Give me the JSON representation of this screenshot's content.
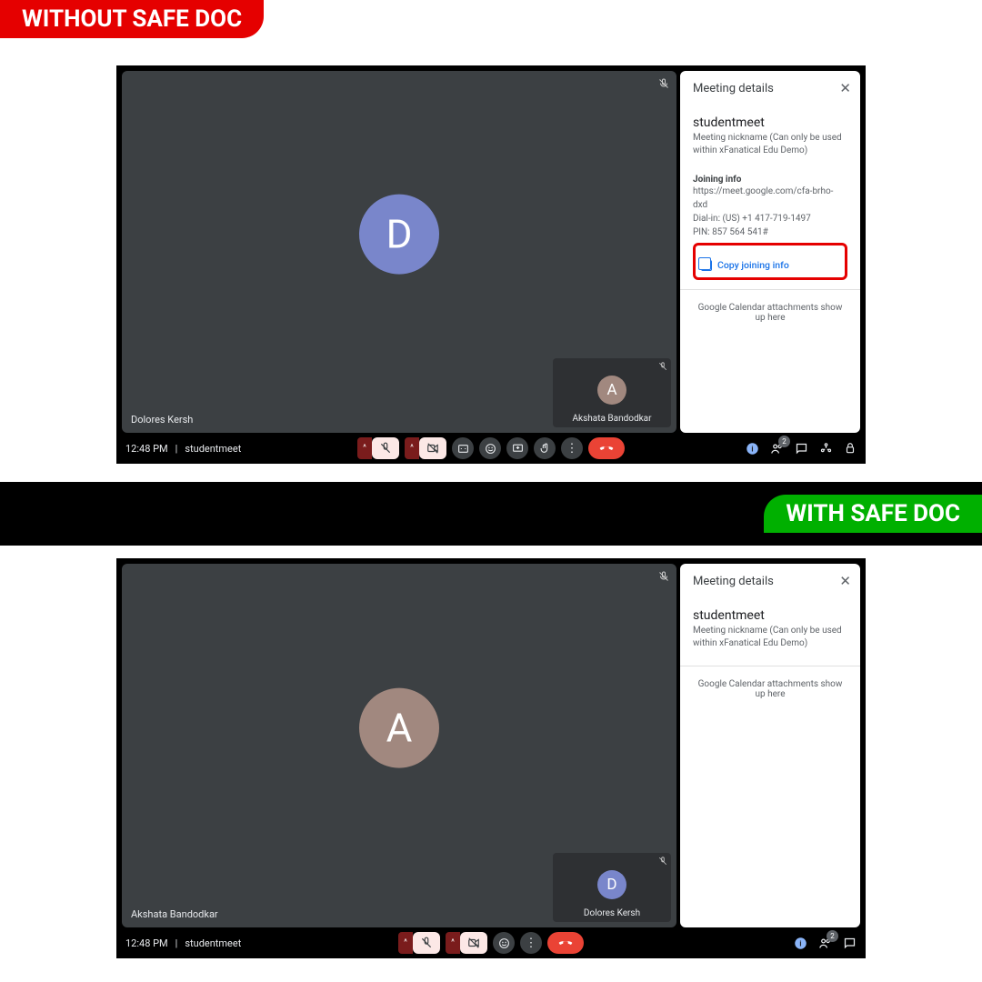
{
  "banners": {
    "top": "WITHOUT SAFE DOC",
    "bottom": "WITH SAFE DOC"
  },
  "shot1": {
    "panel": {
      "title": "Meeting details",
      "meeting_name": "studentmeet",
      "meeting_desc": "Meeting nickname (Can only be used within xFanatical Edu Demo)",
      "joining_header": "Joining info",
      "join_url": "https://meet.google.com/cfa-brho-dxd",
      "dial_in": "Dial-in: (US) +1 417-719-1497",
      "pin": "PIN: 857 564 541#",
      "copy_label": "Copy joining info",
      "attachments": "Google Calendar attachments show up here"
    },
    "main": {
      "letter": "D",
      "name": "Dolores Kersh"
    },
    "tile": {
      "letter": "A",
      "name": "Akshata Bandodkar"
    },
    "bar": {
      "time": "12:48 PM",
      "room": "studentmeet",
      "people_count": "2"
    }
  },
  "shot2": {
    "panel": {
      "title": "Meeting details",
      "meeting_name": "studentmeet",
      "meeting_desc": "Meeting nickname (Can only be used within xFanatical Edu Demo)",
      "attachments": "Google Calendar attachments show up here"
    },
    "main": {
      "letter": "A",
      "name": "Akshata Bandodkar"
    },
    "tile": {
      "letter": "D",
      "name": "Dolores Kersh"
    },
    "bar": {
      "time": "12:48 PM",
      "room": "studentmeet",
      "people_count": "2"
    }
  }
}
